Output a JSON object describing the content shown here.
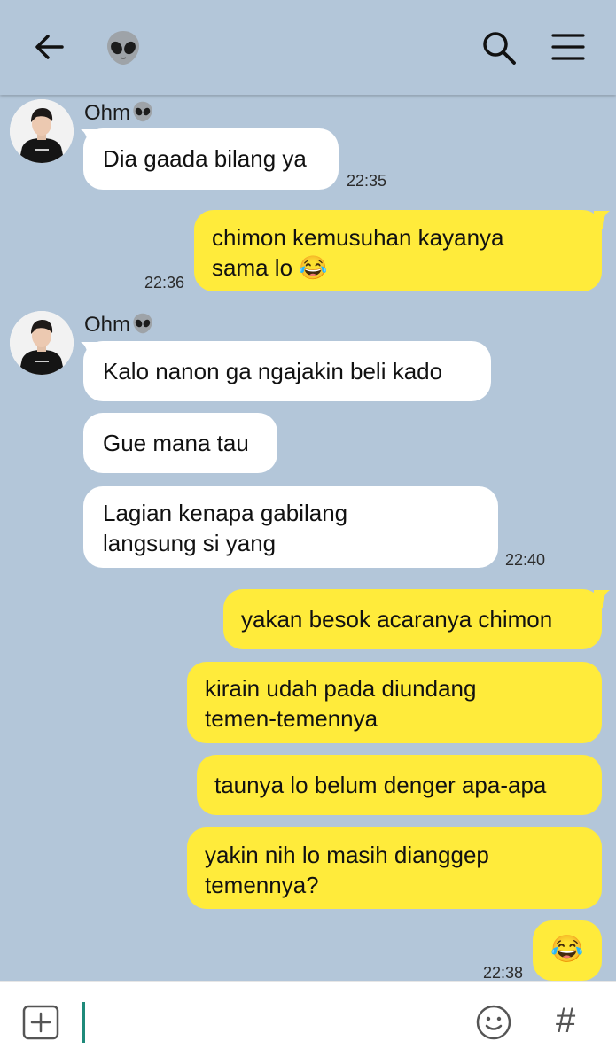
{
  "header": {
    "back_icon": "arrow-left-icon",
    "title_icon": "alien-emoji-icon",
    "search_icon": "search-icon",
    "menu_icon": "hamburger-menu-icon"
  },
  "messages": {
    "group1": {
      "sender": "Ohm",
      "text1": "Dia gaada bilang ya",
      "time": "22:35"
    },
    "out1": {
      "line1": "chimon kemusuhan kayanya",
      "line2": "sama lo",
      "emoji": "😂",
      "time": "22:36"
    },
    "group2": {
      "sender": "Ohm",
      "text1": "Kalo nanon ga ngajakin beli kado",
      "text2": "Gue mana tau",
      "text3_line1": "Lagian kenapa gabilang",
      "text3_line2": "langsung si yang",
      "time": "22:40"
    },
    "out2": {
      "text1": "yakan besok acaranya chimon",
      "text2_line1": "kirain udah pada diundang",
      "text2_line2": "temen-temennya",
      "text3": "taunya lo belum denger apa-apa",
      "text4_line1": "yakin nih lo masih dianggep",
      "text4_line2": "temennya?",
      "emoji": "😂",
      "time": "22:38"
    }
  },
  "input": {
    "add_icon": "plus-square-icon",
    "emoji_icon": "smiley-icon",
    "hashtag": "#"
  },
  "colors": {
    "background": "#b3c6d9",
    "incoming_bubble": "#ffffff",
    "outgoing_bubble": "#ffeb3b",
    "cursor": "#1f8a7a"
  }
}
